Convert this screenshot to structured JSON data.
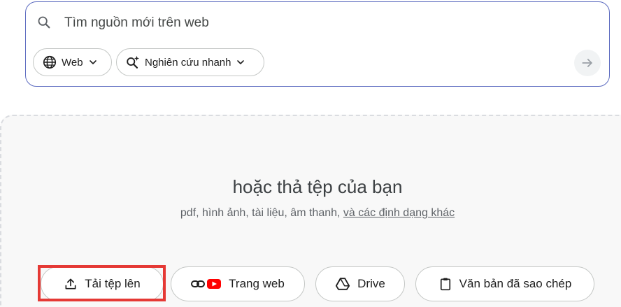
{
  "search": {
    "placeholder": "Tìm nguồn mới trên web",
    "chips": [
      {
        "label": "Web",
        "icon": "globe-icon"
      },
      {
        "label": "Nghiên cứu nhanh",
        "icon": "sparkle-search-icon"
      }
    ],
    "submit_icon": "arrow-right-icon"
  },
  "drop_zone": {
    "title": "hoặc thả tệp của bạn",
    "subtitle_prefix": "pdf, hình ảnh, tài liệu, âm thanh,",
    "subtitle_link": "và các định dạng khác"
  },
  "sources": [
    {
      "label": "Tải tệp lên",
      "icon": "upload-icon"
    },
    {
      "label": "Trang web",
      "icon": "link-youtube-icon"
    },
    {
      "label": "Drive",
      "icon": "drive-icon"
    },
    {
      "label": "Văn bản đã sao chép",
      "icon": "clipboard-icon"
    }
  ],
  "colors": {
    "accent_border": "#5c6bc0",
    "highlight": "#e53935",
    "youtube_red": "#ff0000"
  }
}
